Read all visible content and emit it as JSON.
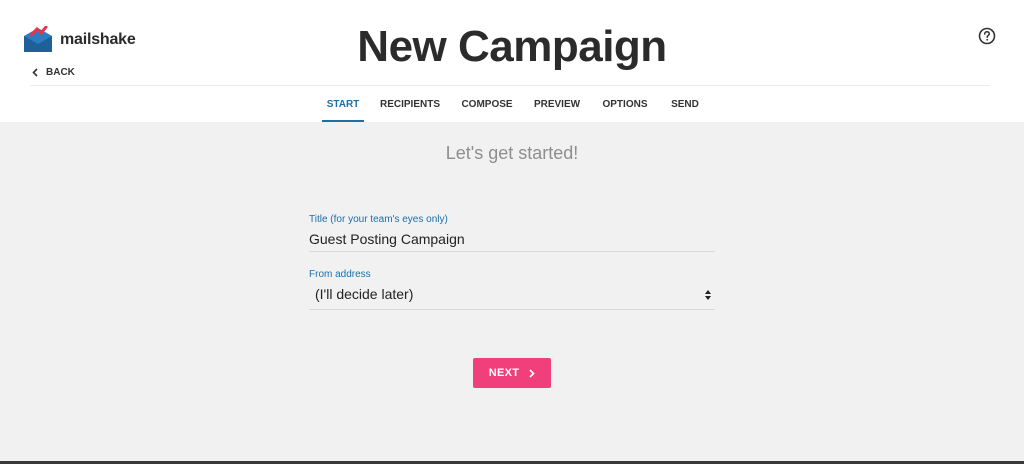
{
  "brand": {
    "name": "mailshake",
    "accent": "#1c6fa6",
    "logo_red": "#e8334a",
    "logo_blue": "#2b7dc0"
  },
  "nav": {
    "back_label": "BACK"
  },
  "header": {
    "title": "New Campaign",
    "help_icon": "question-circle-icon"
  },
  "tabs": [
    {
      "label": "START",
      "active": true
    },
    {
      "label": "RECIPIENTS",
      "active": false
    },
    {
      "label": "COMPOSE",
      "active": false
    },
    {
      "label": "PREVIEW",
      "active": false
    },
    {
      "label": "OPTIONS",
      "active": false
    },
    {
      "label": "SEND",
      "active": false
    }
  ],
  "form": {
    "subtitle": "Let's get started!",
    "title_field": {
      "label": "Title (for your team's eyes only)",
      "value": "Guest Posting Campaign"
    },
    "from_field": {
      "label": "From address",
      "selected": "(I'll decide later)"
    },
    "next_label": "NEXT",
    "next_color": "#f0407c"
  }
}
